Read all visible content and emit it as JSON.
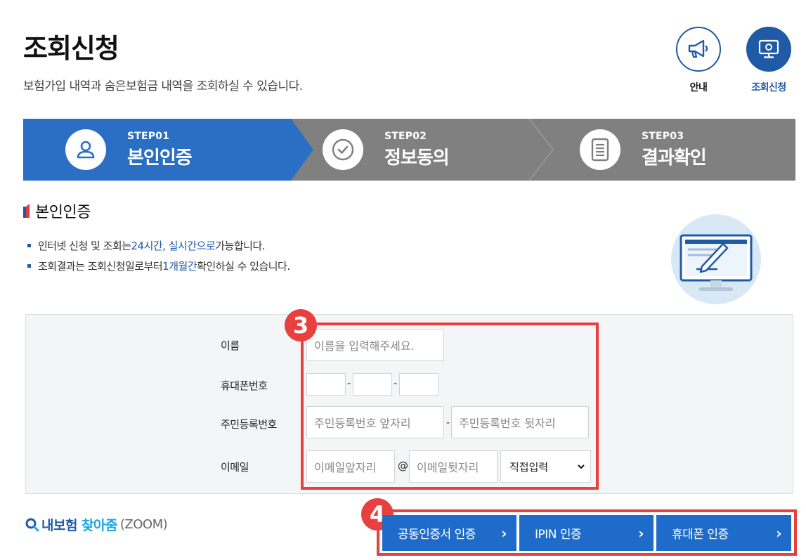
{
  "header": {
    "title": "조회신청",
    "subtitle": "보험가입 내역과 숨은보험금 내역을 조회하실 수 있습니다."
  },
  "top_buttons": {
    "guide_label": "안내",
    "inquiry_label": "조회신청"
  },
  "steps": [
    {
      "num": "STEP01",
      "label": "본인인증",
      "icon": "person-icon",
      "active": true
    },
    {
      "num": "STEP02",
      "label": "정보동의",
      "icon": "check-circle-icon",
      "active": false
    },
    {
      "num": "STEP03",
      "label": "결과확인",
      "icon": "document-icon",
      "active": false
    }
  ],
  "section": {
    "title": "본인인증",
    "notice1_pre": "인터넷 신청 및 조회는 ",
    "notice1_hl": "24시간, 실시간으로",
    "notice1_post": " 가능합니다.",
    "notice2_pre": "조회결과는 조회신청일로부터 ",
    "notice2_hl": "1개월간",
    "notice2_post": " 확인하실 수 있습니다."
  },
  "form": {
    "name_label": "이름",
    "name_placeholder": "이름을 입력해주세요.",
    "phone_label": "휴대폰번호",
    "phone_sep": "-",
    "rrn_label": "주민등록번호",
    "rrn_front_placeholder": "주민등록번호 앞자리",
    "rrn_back_placeholder": "주민등록번호 뒷자리",
    "email_label": "이메일",
    "email_front_placeholder": "이메일앞자리",
    "email_at": "@",
    "email_back_placeholder": "이메일뒷자리",
    "email_domain_selected": "직접입력"
  },
  "annotations": {
    "badge3": "3",
    "badge4": "4"
  },
  "footer": {
    "logo_part1": "내보험",
    "logo_part2": "찾아줌",
    "logo_part3": "(ZOOM)",
    "btn_cert": "공동인증서 인증",
    "btn_ipin": "IPIN 인증",
    "btn_phone": "휴대폰 인증"
  },
  "colors": {
    "primary": "#1f5aa6",
    "step_active": "#2a6fc4",
    "step_inactive": "#808080",
    "highlight": "#e8403e",
    "button": "#1f6bc9"
  }
}
